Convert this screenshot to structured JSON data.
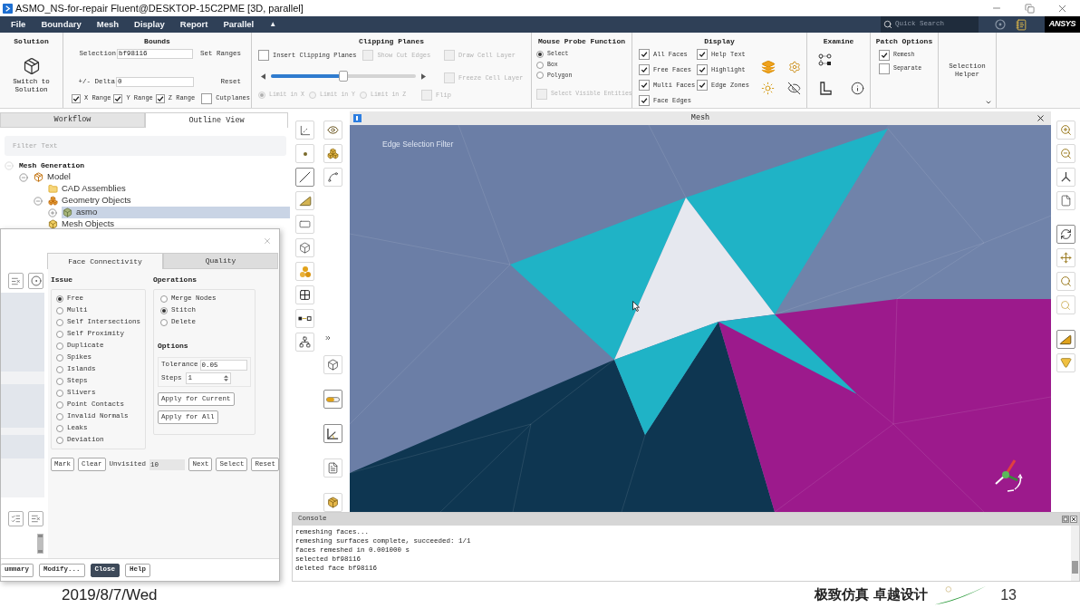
{
  "window": {
    "title": "ASMO_NS-for-repair Fluent@DESKTOP-15C2PME [3D, parallel]"
  },
  "menu": {
    "items": [
      "File",
      "Boundary",
      "Mesh",
      "Display",
      "Report",
      "Parallel"
    ],
    "collapse_glyph": "▲",
    "search": {
      "placeholder": "Quick Search"
    },
    "logo": "ANSYS"
  },
  "ribbon": {
    "solution": {
      "title": "Solution",
      "button": "Switch to Solution"
    },
    "bounds": {
      "title": "Bounds",
      "selection": {
        "label": "Selection",
        "value": "bf98116"
      },
      "set_ranges": "Set Ranges",
      "delta": {
        "label": "+/- Delta",
        "value": "0"
      },
      "reset": "Reset",
      "ranges": [
        {
          "label": "X Range",
          "checked": true
        },
        {
          "label": "Y Range",
          "checked": true
        },
        {
          "label": "Z Range",
          "checked": true
        }
      ],
      "cutplanes": {
        "label": "Cutplanes",
        "checked": false
      }
    },
    "clipping_planes": {
      "title": "Clipping Planes",
      "insert": {
        "label": "Insert Clipping Planes",
        "checked": false,
        "disabled": false
      },
      "show_cut_edges": {
        "label": "Show Cut Edges",
        "checked": false,
        "disabled": true
      },
      "draw_cell_layer": {
        "label": "Draw Cell Layer",
        "checked": false,
        "disabled": true
      },
      "freeze_cell_layer": {
        "label": "Freeze Cell Layer",
        "checked": false,
        "disabled": true
      },
      "slider": {
        "level": 0.5
      },
      "limits": [
        {
          "label": "Limit in X",
          "selected": true,
          "disabled": true
        },
        {
          "label": "Limit in Y",
          "selected": false,
          "disabled": true
        },
        {
          "label": "Limit in Z",
          "selected": false,
          "disabled": true
        }
      ],
      "flip": {
        "label": "Flip",
        "checked": false,
        "disabled": true
      }
    },
    "mouse_probe": {
      "title": "Mouse Probe Function",
      "modes": [
        {
          "label": "Select",
          "selected": true
        },
        {
          "label": "Box",
          "selected": false
        },
        {
          "label": "Polygon",
          "selected": false
        }
      ],
      "select_visible": {
        "label": "Select Visible Entities",
        "checked": false,
        "disabled": true
      }
    },
    "display": {
      "title": "Display",
      "column_1": [
        {
          "label": "All Faces",
          "checked": true
        },
        {
          "label": "Free Faces",
          "checked": true
        },
        {
          "label": "Multi Faces",
          "checked": true
        },
        {
          "label": "Face Edges",
          "checked": true
        }
      ],
      "column_2": [
        {
          "label": "Help Text",
          "checked": true
        },
        {
          "label": "Highlight",
          "checked": true
        },
        {
          "label": "Edge Zones",
          "checked": true
        }
      ]
    },
    "examine": {
      "title": "Examine"
    },
    "patch_options": {
      "title": "Patch Options",
      "options": [
        {
          "label": "Remesh",
          "checked": true
        },
        {
          "label": "Separate",
          "checked": false
        }
      ]
    },
    "selection_helper": {
      "label": "Selection Helper"
    }
  },
  "left_panel": {
    "tabs": [
      {
        "label": "Workflow",
        "selected": false
      },
      {
        "label": "Outline View",
        "selected": true
      }
    ],
    "filter": {
      "placeholder": "Filter Text"
    },
    "tree": [
      {
        "label": "Mesh Generation",
        "kind": "root",
        "expanded": true,
        "selected": false,
        "children": [
          {
            "label": "Model",
            "kind": "model",
            "expanded": true,
            "selected": false,
            "children": [
              {
                "label": "CAD Assemblies",
                "kind": "assemblies",
                "selected": false
              },
              {
                "label": "Geometry Objects",
                "kind": "geometry",
                "expanded": true,
                "selected": false,
                "children": [
                  {
                    "label": "asmo",
                    "kind": "object",
                    "expanded": false,
                    "selected": true
                  }
                ]
              },
              {
                "label": "Mesh Objects",
                "kind": "mesh",
                "selected": false
              }
            ]
          }
        ]
      }
    ]
  },
  "viewport": {
    "title": "Mesh",
    "hint": "Edge Selection Filter"
  },
  "dialog": {
    "tabs": [
      {
        "label": "Face Connectivity",
        "selected": true
      },
      {
        "label": "Quality",
        "selected": false
      }
    ],
    "issue": {
      "title": "Issue",
      "options": [
        {
          "label": "Free",
          "selected": true
        },
        {
          "label": "Multi",
          "selected": false
        },
        {
          "label": "Self Intersections",
          "selected": false
        },
        {
          "label": "Self Proximity",
          "selected": false
        },
        {
          "label": "Duplicate",
          "selected": false
        },
        {
          "label": "Spikes",
          "selected": false
        },
        {
          "label": "Islands",
          "selected": false
        },
        {
          "label": "Steps",
          "selected": false
        },
        {
          "label": "Slivers",
          "selected": false
        },
        {
          "label": "Point Contacts",
          "selected": false
        },
        {
          "label": "Invalid Normals",
          "selected": false
        },
        {
          "label": "Leaks",
          "selected": false
        },
        {
          "label": "Deviation",
          "selected": false
        }
      ]
    },
    "operations": {
      "title": "Operations",
      "options": [
        {
          "label": "Merge Nodes",
          "selected": false
        },
        {
          "label": "Stitch",
          "selected": true
        },
        {
          "label": "Delete",
          "selected": false
        }
      ]
    },
    "options": {
      "title": "Options",
      "tolerance": {
        "label": "Tolerance",
        "value": "0.05"
      },
      "steps": {
        "label": "Steps",
        "value": "1"
      }
    },
    "apply_buttons": [
      "Apply for Current",
      "Apply for All"
    ],
    "mark_button": "Mark",
    "clear_button": "Clear",
    "unvisited": {
      "label": "Unvisited",
      "value": "10"
    },
    "nav_buttons": [
      "Next",
      "Select",
      "Reset"
    ],
    "footer_buttons": [
      {
        "label": "ummary",
        "default": false
      },
      {
        "label": "Modify...",
        "default": false
      },
      {
        "label": "Close",
        "default": true
      },
      {
        "label": "Help",
        "default": false
      }
    ]
  },
  "console": {
    "title": "Console",
    "lines": [
      "remeshing faces...",
      "remeshing surfaces complete, succeeded: 1/1",
      "faces remeshed in 0.001000 s",
      "selected bf98116",
      "deleted face bf98116"
    ]
  },
  "slide_footer": {
    "date": "2019/8/7/Wed",
    "slogan": "极致仿真 卓越设计",
    "page": "13"
  }
}
